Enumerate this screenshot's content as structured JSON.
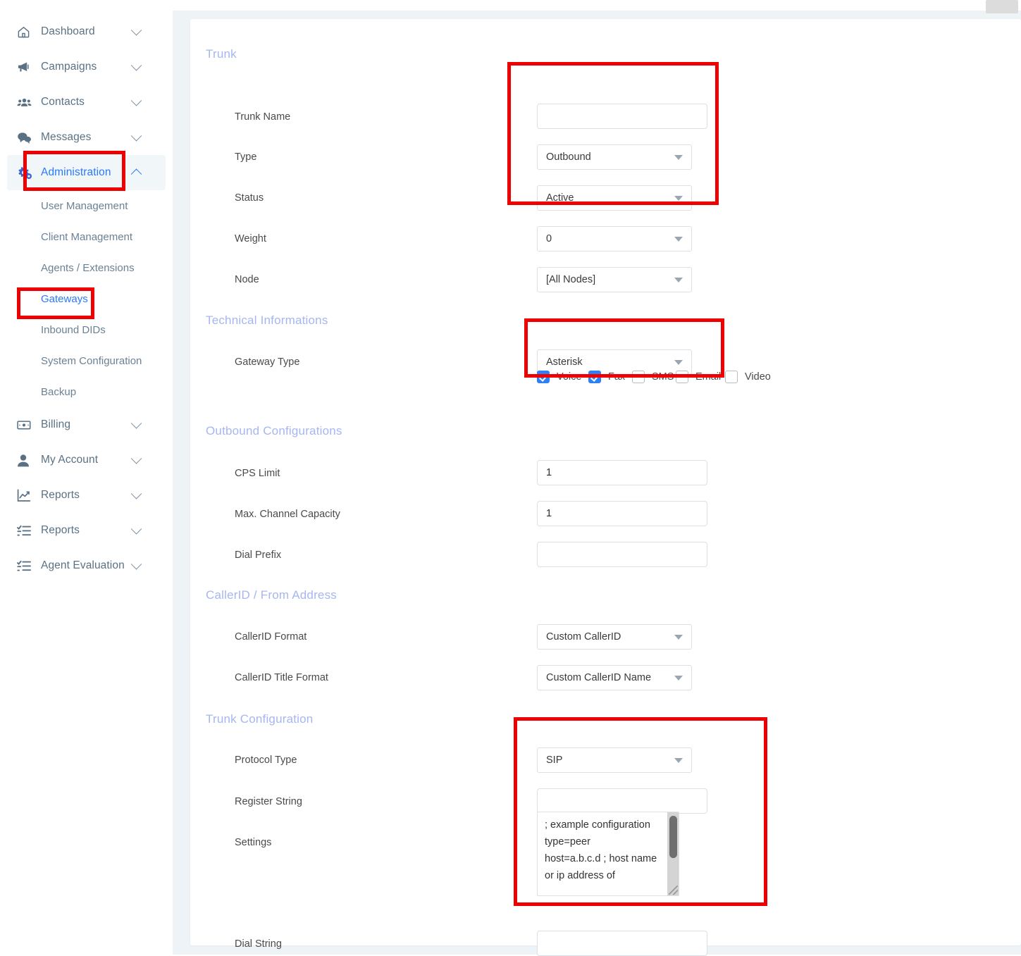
{
  "sidebar": {
    "items": [
      {
        "label": "Dashboard",
        "icon": "home-icon",
        "chevron": "down",
        "active": false
      },
      {
        "label": "Campaigns",
        "icon": "megaphone-icon",
        "chevron": "down",
        "active": false
      },
      {
        "label": "Contacts",
        "icon": "people-icon",
        "chevron": "down",
        "active": false
      },
      {
        "label": "Messages",
        "icon": "chat-icon",
        "chevron": "down",
        "active": false
      },
      {
        "label": "Administration",
        "icon": "gears-icon",
        "chevron": "up",
        "active": true
      }
    ],
    "sub_items": [
      {
        "label": "User Management",
        "selected": false
      },
      {
        "label": "Client Management",
        "selected": false
      },
      {
        "label": "Agents / Extensions",
        "selected": false
      },
      {
        "label": "Gateways",
        "selected": true
      },
      {
        "label": "Inbound DIDs",
        "selected": false
      },
      {
        "label": "System Configuration",
        "selected": false
      },
      {
        "label": "Backup",
        "selected": false
      }
    ],
    "items_bottom": [
      {
        "label": "Billing",
        "icon": "money-bill-icon",
        "chevron": "down"
      },
      {
        "label": "My Account",
        "icon": "user-icon",
        "chevron": "down"
      },
      {
        "label": "Reports",
        "icon": "chart-line-icon",
        "chevron": "down"
      },
      {
        "label": "Reports",
        "icon": "list-check-icon",
        "chevron": "down"
      },
      {
        "label": "Agent Evaluation",
        "icon": "list-check-icon",
        "chevron": "down"
      }
    ]
  },
  "sections": {
    "trunk": "Trunk",
    "technical": "Technical Informations",
    "outbound": "Outbound Configurations",
    "callerid": "CallerID / From Address",
    "trunk_config": "Trunk Configuration"
  },
  "fields": {
    "trunk_name": {
      "label": "Trunk Name",
      "value": "",
      "placeholder": ""
    },
    "type": {
      "label": "Type",
      "value": "Outbound"
    },
    "status": {
      "label": "Status",
      "value": "Active"
    },
    "weight": {
      "label": "Weight",
      "value": "0"
    },
    "node": {
      "label": "Node",
      "value": "[All Nodes]"
    },
    "gateway_type": {
      "label": "Gateway Type",
      "value": "Asterisk"
    },
    "cps_limit": {
      "label": "CPS Limit",
      "value": "1",
      "placeholder": ""
    },
    "max_channel": {
      "label": "Max. Channel Capacity",
      "value": "1",
      "placeholder": ""
    },
    "dial_prefix": {
      "label": "Dial Prefix",
      "value": "",
      "placeholder": ""
    },
    "callerid_format": {
      "label": "CallerID Format",
      "value": "Custom CallerID"
    },
    "callerid_title": {
      "label": "CallerID Title Format",
      "value": "Custom CallerID Name"
    },
    "protocol_type": {
      "label": "Protocol Type",
      "value": "SIP"
    },
    "register_string": {
      "label": "Register String",
      "value": "",
      "placeholder": ""
    },
    "settings": {
      "label": "Settings",
      "value": "; example configuration\ntype=peer\nhost=a.b.c.d ; host name or ip address of"
    },
    "dial_string": {
      "label": "Dial String",
      "value": "",
      "placeholder": ""
    }
  },
  "media_checkboxes": [
    {
      "label": "Voice",
      "checked": true
    },
    {
      "label": "Fax",
      "checked": true
    },
    {
      "label": "SMS",
      "checked": false
    },
    {
      "label": "Email",
      "checked": false
    },
    {
      "label": "Video",
      "checked": false
    }
  ],
  "topbar": {
    "button_label": ""
  },
  "colors": {
    "accent": "#2979ff",
    "section_title": "#a7b6f0",
    "sidebar_text": "#5a7184",
    "checkbox_on": "#2f80f5",
    "annotation": "#ee0000",
    "page_bg": "#eef3f6"
  }
}
